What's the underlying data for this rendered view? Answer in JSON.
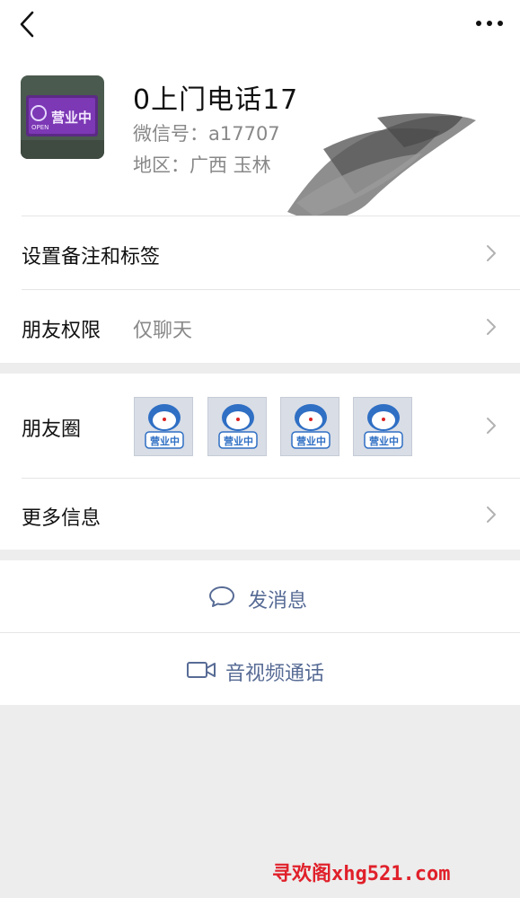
{
  "header": {
    "back_icon": "chevron-left-icon",
    "more_icon": "more-dots-icon"
  },
  "profile": {
    "name": "0上门电话17",
    "wechat_id": "微信号：a17707",
    "region": "地区：广西  玉林",
    "avatar_text_top": "营业中",
    "avatar_text_open": "OPEN"
  },
  "rows": {
    "remark_label": "设置备注和标签",
    "permission_label": "朋友权限",
    "permission_value": "仅聊天",
    "moments_label": "朋友圈",
    "more_info_label": "更多信息"
  },
  "moments_thumbs": [
    {
      "text": "营业中"
    },
    {
      "text": "营业中"
    },
    {
      "text": "营业中"
    },
    {
      "text": "营业中"
    }
  ],
  "actions": {
    "message_label": "发消息",
    "call_label": "音视频通话"
  },
  "watermark": "寻欢阁xhg521.com",
  "colors": {
    "link": "#576b95",
    "background": "#ededed",
    "watermark": "#e0202a"
  }
}
